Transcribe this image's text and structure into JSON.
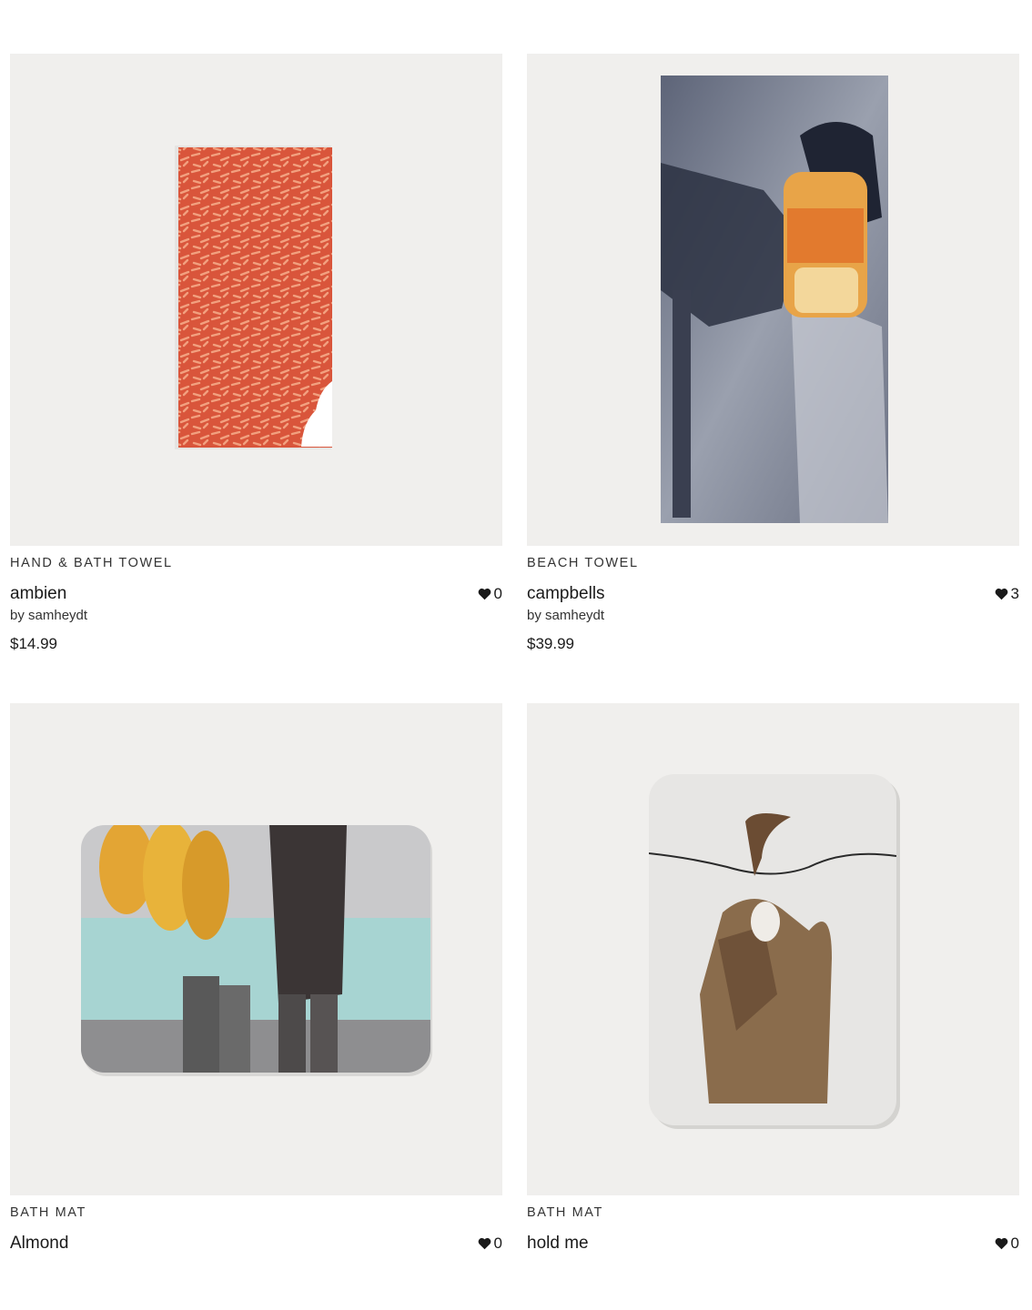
{
  "products": [
    {
      "category": "HAND & BATH TOWEL",
      "title": "ambien",
      "likes": "0",
      "by": "by samheydt",
      "price": "$14.99"
    },
    {
      "category": "BEACH TOWEL",
      "title": "campbells",
      "likes": "3",
      "by": "by samheydt",
      "price": "$39.99"
    },
    {
      "category": "BATH MAT",
      "title": "Almond",
      "likes": "0"
    },
    {
      "category": "BATH MAT",
      "title": "hold me",
      "likes": "0"
    }
  ]
}
